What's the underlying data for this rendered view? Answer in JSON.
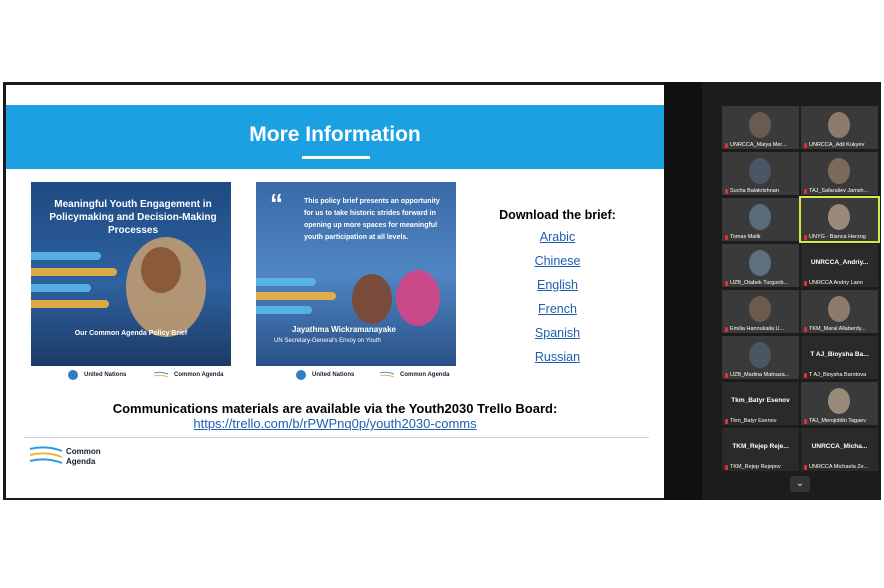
{
  "slide": {
    "title": "More Information",
    "card1": {
      "title": "Meaningful Youth Engagement in Policymaking and Decision-Making Processes",
      "caption": "Our Common Agenda Policy Brief"
    },
    "card2": {
      "quote_mark": "“",
      "quote": "This policy brief presents an opportunity for us to take historic strides forward in opening up more spaces for meaningful youth participation at all levels.",
      "person_name": "Jayathma Wickramanayake",
      "person_role": "UN Secretary-General's Envoy on Youth"
    },
    "logos": {
      "un": "United Nations",
      "ca": "Common Agenda"
    },
    "download_title": "Download the brief:",
    "languages": [
      "Arabic",
      "Chinese",
      "English",
      "French",
      "Spanish",
      "Russian"
    ],
    "comm_text": "Communications materials are available via the Youth2030 Trello Board:",
    "comm_link": "https://trello.com/b/rPWPnq0p/youth2030-comms",
    "footer_logo": "Common Agenda"
  },
  "gallery": {
    "participants": [
      {
        "label": "UNRCCA_Maiya Mer...",
        "type": "video"
      },
      {
        "label": "UNRCCA_Adil Kukyev",
        "type": "video"
      },
      {
        "label": "Sucha Balakrishnan",
        "type": "video"
      },
      {
        "label": "TAJ_Safaraliev Jamsh...",
        "type": "video"
      },
      {
        "label": "Tomas Malik",
        "type": "video"
      },
      {
        "label": "UNYG - Bianca Herzog",
        "type": "video",
        "active": true
      },
      {
        "label": "UZB_Otabek Turgunb...",
        "type": "video"
      },
      {
        "label": "UNRCCA Andriy Lann",
        "type": "name",
        "name": "UNRCCA_Andriy..."
      },
      {
        "label": "Emilia Hannukaila U...",
        "type": "video"
      },
      {
        "label": "TKM_Maral Allaberdy...",
        "type": "video"
      },
      {
        "label": "UZB_Madina Matnaza...",
        "type": "video"
      },
      {
        "label": "T AJ_Bioysha Barotova",
        "type": "name",
        "name": "T AJ_Bioysha Ba..."
      },
      {
        "label": "Tkm_Batyr Esenov",
        "type": "name",
        "name": "Tkm_Batyr Esenov"
      },
      {
        "label": "TAJ_Merojiddin Tagaev",
        "type": "video"
      },
      {
        "label": "TKM_Rejep Rejepov",
        "type": "name",
        "name": "TKM_Rejep Reje..."
      },
      {
        "label": "UNRCCA Michaela Ze...",
        "type": "name",
        "name": "UNRCCA_Micha..."
      }
    ]
  },
  "colors": {
    "banner": "#1ba1e2",
    "link": "#1f5fb0",
    "active_outline": "#d8e84a"
  }
}
